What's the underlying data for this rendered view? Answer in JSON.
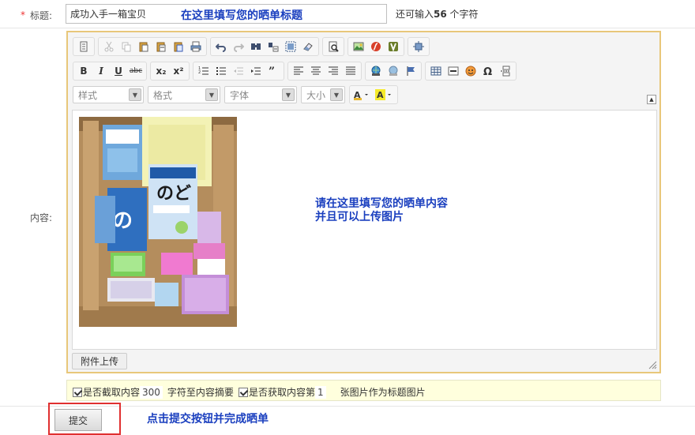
{
  "title_row": {
    "required_mark": "*",
    "label": "标题:",
    "value": "成功入手一箱宝贝",
    "annotation": "在这里填写您的晒单标题",
    "remaining_prefix": "还可输入",
    "remaining_count": "56",
    "remaining_suffix": " 个字符"
  },
  "content_row": {
    "label": "内容:"
  },
  "editor": {
    "toolbar_row1_icons": [
      "source-icon",
      "cut-icon",
      "copy-icon",
      "paste-icon",
      "paste-text-icon",
      "paste-word-icon",
      "print-icon",
      "undo-icon",
      "redo-icon",
      "find-icon",
      "replace-icon",
      "select-all-icon",
      "remove-format-icon",
      "preview-icon",
      "image-icon",
      "flash-icon",
      "video-icon",
      "maximize-icon"
    ],
    "toolbar_row2": {
      "bold": "B",
      "italic": "I",
      "underline": "U",
      "strike": "abc",
      "subscript": "x₂",
      "superscript": "x²"
    },
    "combos": {
      "style": "样式",
      "format": "格式",
      "font": "字体",
      "size": "大小"
    },
    "annotation_line1": "请在这里填写您的晒单内容",
    "annotation_line2": "并且可以上传图片",
    "attach_label": "附件上传"
  },
  "options": {
    "opt1_label": "是否截取内容",
    "opt1_value": "300",
    "opt1_suffix": "字符至内容摘要",
    "opt2_label": "是否获取内容第",
    "opt2_value": "1",
    "opt2_suffix": "张图片作为标题图片"
  },
  "submit": {
    "label": "提交",
    "annotation": "点击提交按钮并完成晒单"
  },
  "colors": {
    "annotation_blue": "#1a3fbf",
    "editor_border": "#e8c77a",
    "highlight_red": "#e03030",
    "options_bg": "#ffffdd"
  }
}
